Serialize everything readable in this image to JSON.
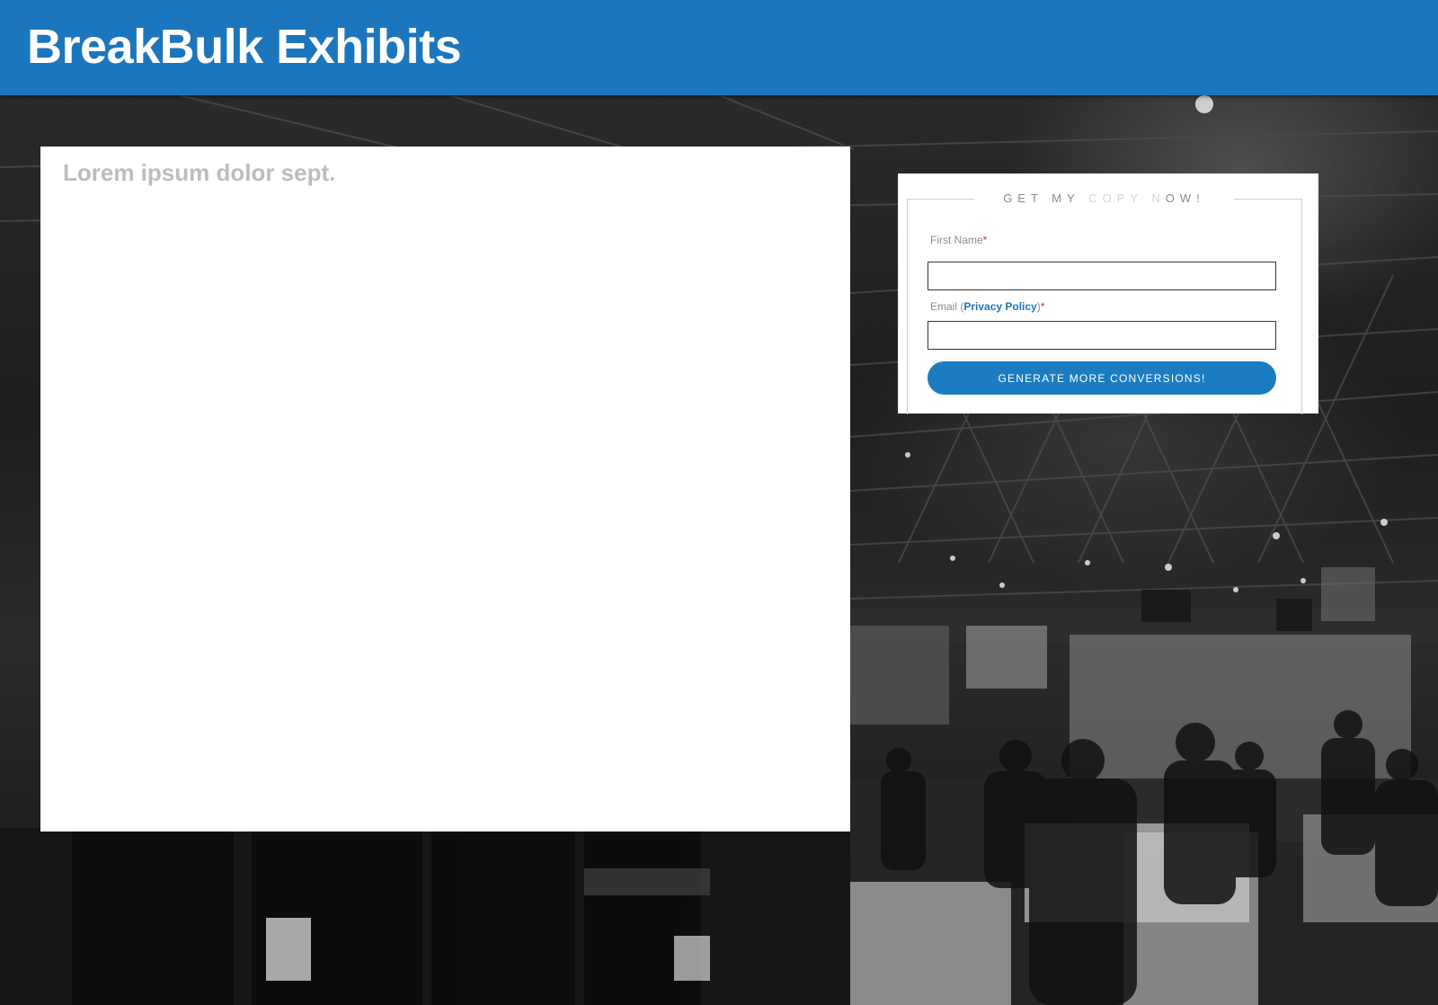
{
  "header": {
    "title": "BreakBulk Exhibits"
  },
  "content": {
    "heading": "Lorem ipsum dolor sept."
  },
  "form": {
    "legend_parts": [
      "GET MY ",
      "C",
      "OPY N",
      "O",
      "W!"
    ],
    "first_name_label": "First Name",
    "email_label_prefix": "Email (",
    "privacy_link_text": "Privacy Policy",
    "email_label_suffix": ")",
    "required_marker": "*",
    "first_name_value": "",
    "email_value": "",
    "submit_label": "GENERATE MORE CONVERSIONS!"
  },
  "colors": {
    "brand_blue": "#1c76bd",
    "button_blue": "#1c7cc1",
    "required_red": "#d0342c"
  }
}
